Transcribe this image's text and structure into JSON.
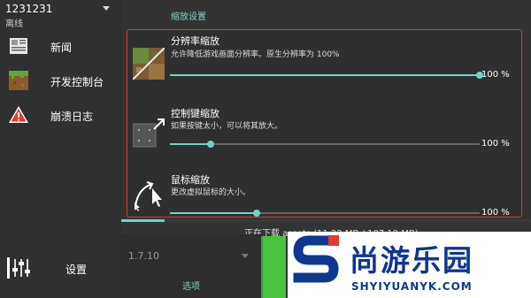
{
  "sidebar": {
    "account": "1231231",
    "status": "离线",
    "items": [
      {
        "label": "新闻",
        "icon": "news-icon"
      },
      {
        "label": "开发控制台",
        "icon": "dirt-block-icon"
      },
      {
        "label": "崩溃日志",
        "icon": "warning-icon"
      }
    ],
    "settings_label": "设置",
    "settings_icon": "sliders-icon"
  },
  "main": {
    "section_title": "缩放设置",
    "settings": [
      {
        "title": "分辨率缩放",
        "description": "允许降低游戏画面分辨率。原生分辨率为 100%",
        "value": "100 %",
        "level": 100,
        "icon": "resolution-scale-icon"
      },
      {
        "title": "控制键缩放",
        "description": "如果按键太小，可以将其放大。",
        "value": "100 %",
        "level": 13,
        "icon": "control-scale-icon"
      },
      {
        "title": "鼠标缩放",
        "description": "更改虚拟鼠标的大小。",
        "value": "100 %",
        "level": 28,
        "icon": "mouse-scale-icon"
      }
    ]
  },
  "footer": {
    "download_status": "正在下载 assets (11.22 MB / 107.19 MB)",
    "download_progress": 0.105,
    "version": "1.7.10",
    "options_label": "选项"
  },
  "watermark": {
    "brand": "尚游乐园",
    "url": "SHYIYUANYK.COM"
  },
  "colors": {
    "accent": "#6fd3c9",
    "highlight_border": "#e2382f",
    "brand": "#0e3790",
    "play": "#47c33f"
  }
}
